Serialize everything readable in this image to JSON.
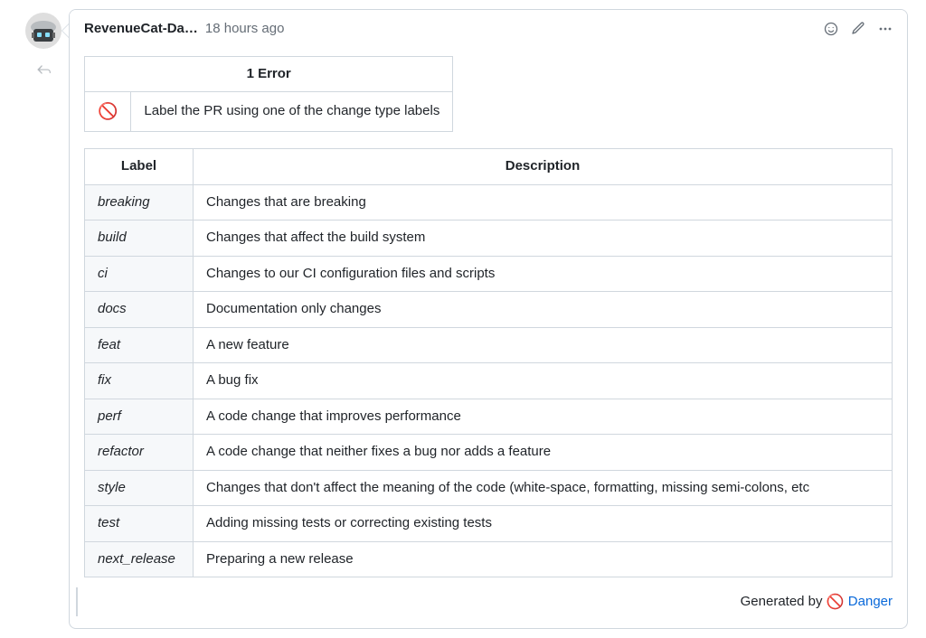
{
  "comment": {
    "author": "RevenueCat-Da…",
    "timestamp": "18 hours ago"
  },
  "error_table": {
    "header": "1 Error",
    "icon": "🚫",
    "message": "Label the PR using one of the change type labels"
  },
  "labels_table": {
    "headers": {
      "label": "Label",
      "description": "Description"
    },
    "rows": [
      {
        "label": "breaking",
        "description": "Changes that are breaking"
      },
      {
        "label": "build",
        "description": "Changes that affect the build system"
      },
      {
        "label": "ci",
        "description": "Changes to our CI configuration files and scripts"
      },
      {
        "label": "docs",
        "description": "Documentation only changes"
      },
      {
        "label": "feat",
        "description": "A new feature"
      },
      {
        "label": "fix",
        "description": "A bug fix"
      },
      {
        "label": "perf",
        "description": "A code change that improves performance"
      },
      {
        "label": "refactor",
        "description": "A code change that neither fixes a bug nor adds a feature"
      },
      {
        "label": "style",
        "description": "Changes that don't affect the meaning of the code (white-space, formatting, missing semi-colons, etc"
      },
      {
        "label": "test",
        "description": "Adding missing tests or correcting existing tests"
      },
      {
        "label": "next_release",
        "description": "Preparing a new release"
      }
    ]
  },
  "footer": {
    "prefix": "Generated by",
    "icon": "🚫",
    "link_text": "Danger"
  }
}
